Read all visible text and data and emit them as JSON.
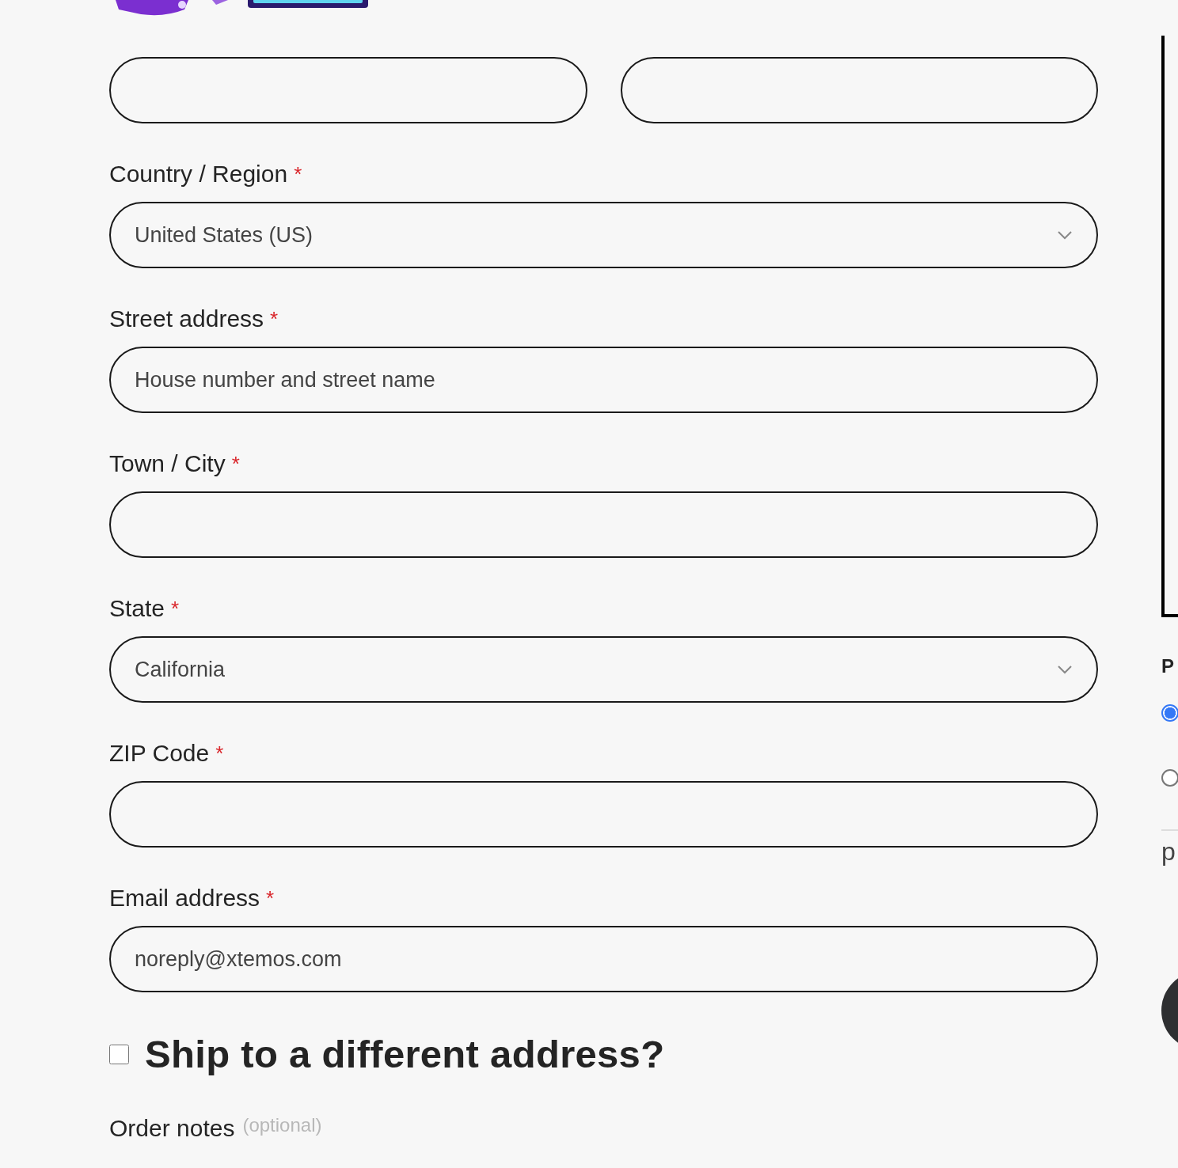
{
  "name_fields": [
    {
      "kind": "text"
    },
    {
      "kind": "text"
    }
  ],
  "fields": [
    {
      "label": "Country / Region",
      "required_mark": "*",
      "kind": "select",
      "value": "United States (US)"
    },
    {
      "label": "Street address",
      "required_mark": "*",
      "kind": "text",
      "placeholder": "House number and street name"
    },
    {
      "label": "Town / City",
      "required_mark": "*",
      "kind": "text"
    },
    {
      "label": "State",
      "required_mark": "*",
      "kind": "select",
      "value": "California"
    },
    {
      "label": "ZIP Code",
      "required_mark": "*",
      "kind": "text"
    },
    {
      "label": "Email address",
      "required_mark": "*",
      "kind": "text",
      "value": "noreply@xtemos.com"
    }
  ],
  "ship_different": {
    "label": "Ship to a different address?",
    "checked": false
  },
  "order_notes": {
    "label": "Order notes",
    "hint": "(optional)"
  },
  "side": {
    "heading": "P",
    "options": [
      {
        "selected": true
      },
      {
        "selected": false
      }
    ],
    "text_lines": [
      "p"
    ]
  }
}
